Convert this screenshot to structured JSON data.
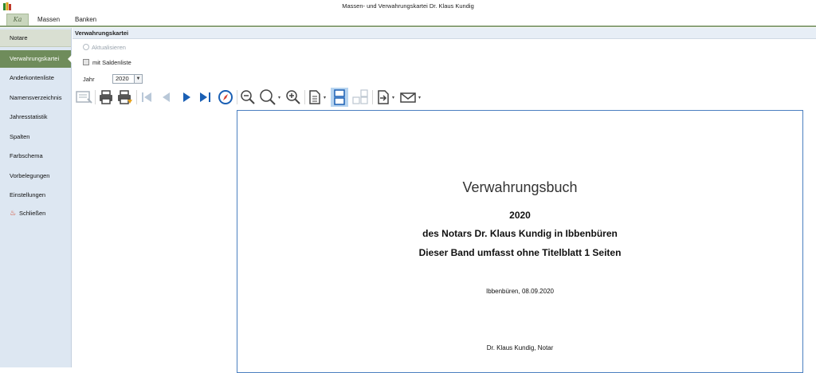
{
  "window": {
    "title": "Massen- und Verwahrungskartei Dr. Klaus Kundig"
  },
  "menu": {
    "logo": "Ka",
    "items": [
      "Massen",
      "Banken"
    ]
  },
  "sidebar": {
    "items": [
      {
        "label": "Notare"
      },
      {
        "label": "Verwahrungskartei"
      },
      {
        "label": "Anderkontenliste"
      },
      {
        "label": "Namensverzeichnis"
      },
      {
        "label": "Jahresstatistik"
      },
      {
        "label": "Spalten"
      },
      {
        "label": "Farbschema"
      },
      {
        "label": "Vorbelegungen"
      },
      {
        "label": "Einstellungen"
      },
      {
        "label": "Schließen",
        "icon": "close-icon"
      }
    ],
    "active_index": 1
  },
  "content": {
    "header": "Verwahrungskartei",
    "refresh_label": "Aktualisieren",
    "saldo_label": "mit Saldenliste",
    "saldo_checked": false,
    "year_label": "Jahr",
    "year_value": "2020"
  },
  "toolbar": {
    "icons": [
      "select-tool-icon",
      "print-icon",
      "quick-print-icon",
      "first-page-icon",
      "previous-page-icon",
      "next-page-icon",
      "last-page-icon",
      "navigate-icon",
      "zoom-out-icon",
      "zoom-icon",
      "zoom-in-icon",
      "page-setup-icon",
      "single-page-icon",
      "multi-page-icon",
      "export-icon",
      "email-icon"
    ]
  },
  "document": {
    "title": "Verwahrungsbuch",
    "year": "2020",
    "notary_line": "des Notars Dr. Klaus Kundig in Ibbenbüren",
    "band_line": "Dieser Band umfasst ohne Titelblatt 1 Seiten",
    "place_date": "Ibbenbüren, 08.09.2020",
    "signature": "Dr. Klaus Kundig, Notar"
  },
  "colors": {
    "accent_green": "#6f8c5b",
    "sidebar_bg": "#dde7f2",
    "page_border": "#4b7fc0",
    "toolbar_blue": "#1a5fb4"
  }
}
